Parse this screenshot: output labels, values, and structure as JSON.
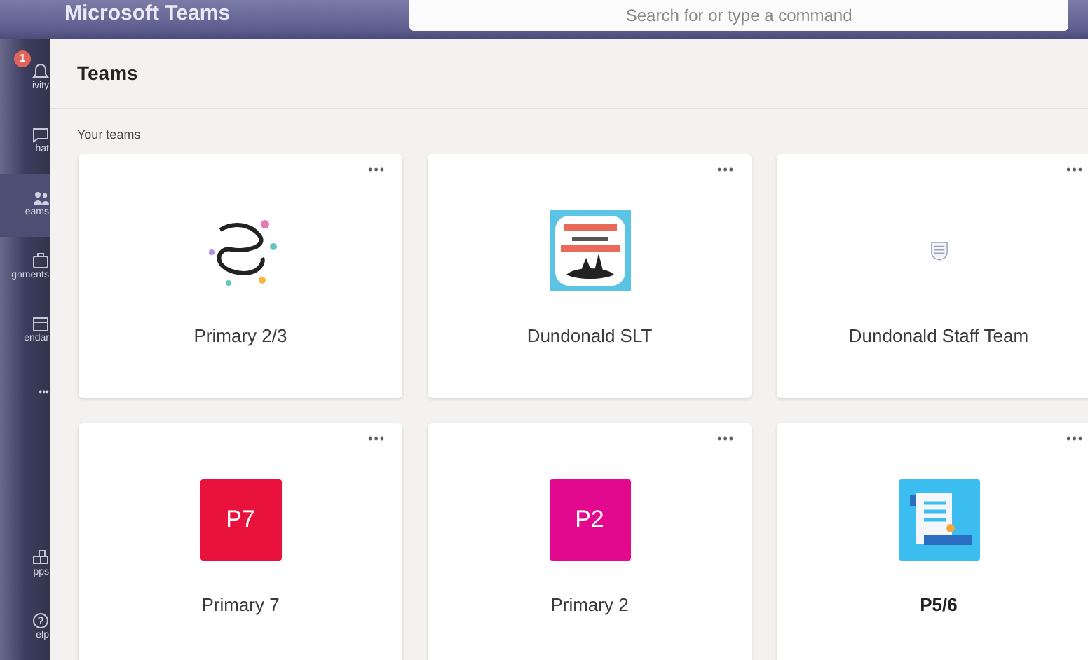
{
  "title_bar": {
    "app_title": "Microsoft Teams",
    "search": {
      "placeholder": "Search for or type a command"
    }
  },
  "rail": [
    {
      "label": "ivity",
      "selected": false,
      "badge": "1"
    },
    {
      "label": "hat",
      "selected": false
    },
    {
      "label": "eams",
      "selected": true
    },
    {
      "label": "gnments",
      "selected": false
    },
    {
      "label": "endar",
      "selected": false
    },
    {
      "label": "•••",
      "selected": false
    },
    {
      "label": "pps",
      "selected": false
    },
    {
      "label": "elp",
      "selected": false
    }
  ],
  "header": {
    "title": "Teams"
  },
  "section_label": "Your teams",
  "teams": [
    {
      "name": "Primary 2/3",
      "kind": "picture",
      "unread": false
    },
    {
      "name": "Dundonald SLT",
      "kind": "picture",
      "unread": false
    },
    {
      "name": "Dundonald Staff Team",
      "kind": "crest",
      "unread": false
    },
    {
      "name": "Primary 7",
      "kind": "initials",
      "initials": "P7",
      "color": "#e8123c",
      "unread": false
    },
    {
      "name": "Primary 2",
      "kind": "initials",
      "initials": "P2",
      "color": "#e2098f",
      "unread": false
    },
    {
      "name": "P5/6",
      "kind": "scroll",
      "unread": true
    }
  ],
  "more_label": "•••"
}
